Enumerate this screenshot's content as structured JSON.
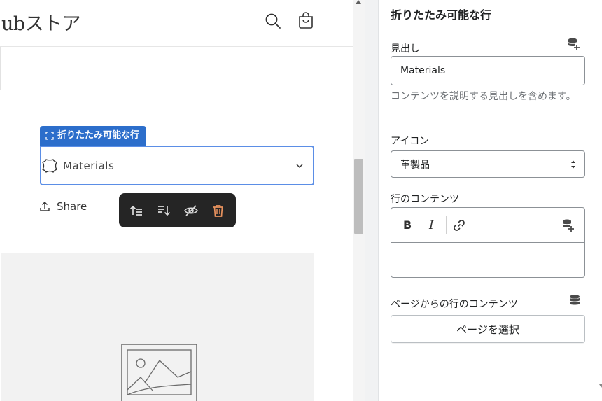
{
  "store": {
    "logo_text": "ubストア",
    "icons": [
      "search-icon",
      "cart-icon"
    ]
  },
  "preview": {
    "block_tag": "折りたたみ可能な行",
    "collapsible_row": {
      "label": "Materials",
      "icon": "leather-icon",
      "chevron": "chevron-down-icon"
    },
    "share_label": "Share",
    "floating_toolbar": [
      "move-up-icon",
      "move-down-icon",
      "hide-icon",
      "delete-icon"
    ],
    "delete_color": "#e8925e",
    "selection_color": "#2c6ecb",
    "placeholder_icon": "image-placeholder-icon"
  },
  "panel": {
    "title": "折りたたみ可能な行",
    "heading": {
      "label": "見出し",
      "value": "Materials",
      "help": "コンテンツを説明する見出しを含めます。"
    },
    "icon_field": {
      "label": "アイコン",
      "selected": "革製品"
    },
    "row_content": {
      "label": "行のコンテンツ",
      "bold": "B",
      "italic": "I"
    },
    "page_content": {
      "label": "ページからの行のコンテンツ",
      "button": "ページを選択"
    }
  }
}
